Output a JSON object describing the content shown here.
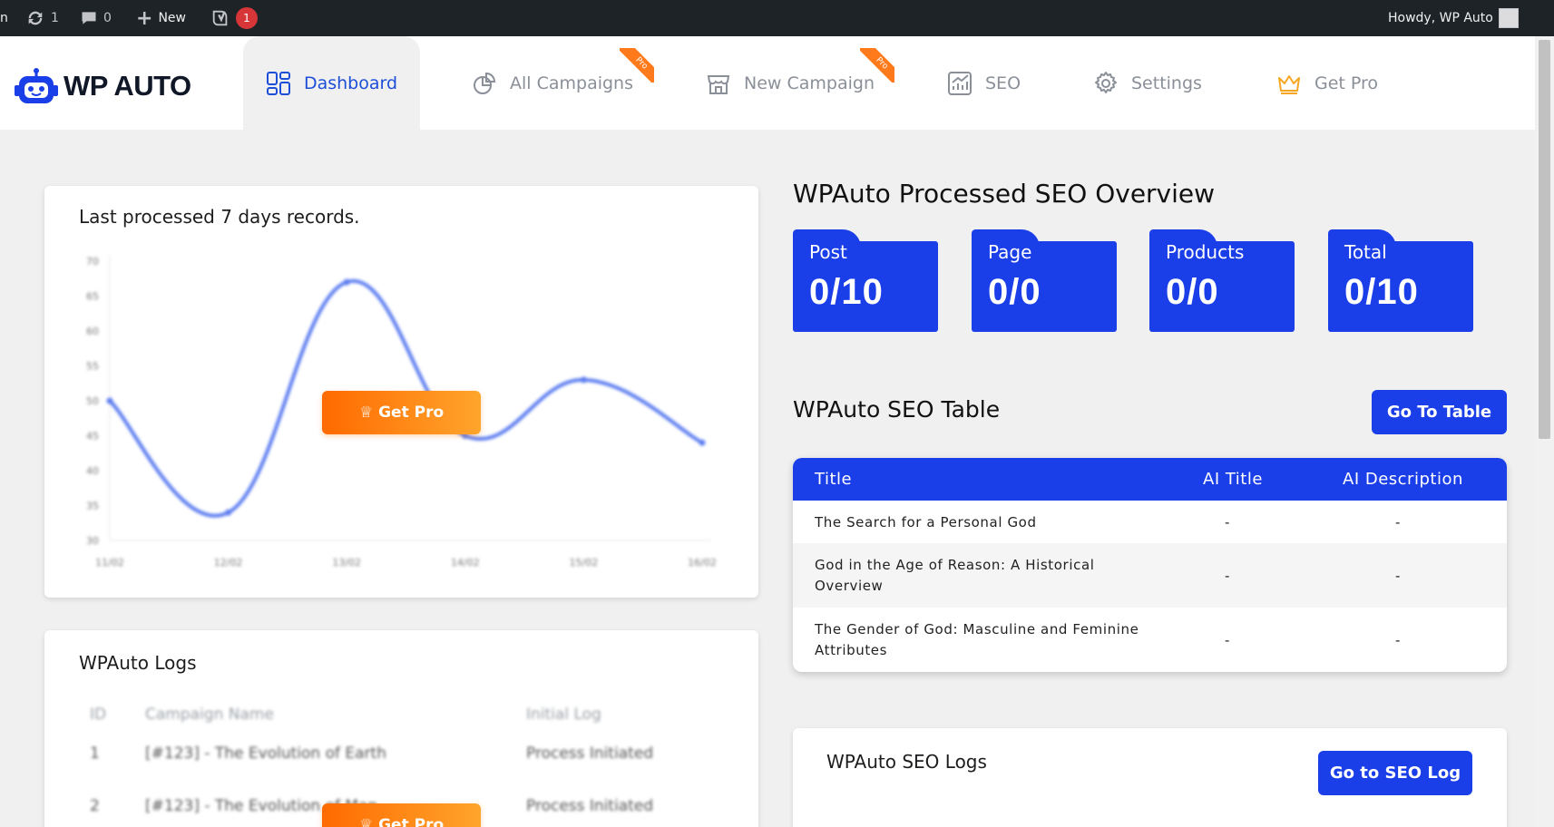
{
  "adminbar": {
    "cut_glyph": "n",
    "updates_count": "1",
    "comments_count": "0",
    "new_label": "New",
    "yoast_badge": "1",
    "howdy": "Howdy, WP Auto"
  },
  "brand": {
    "logo_text": "WP AUTO"
  },
  "nav": {
    "tabs": [
      {
        "label": "Dashboard",
        "icon": "dashboard-grid-icon",
        "active": true
      },
      {
        "label": "All Campaigns",
        "icon": "campaigns-icon",
        "badge": "Pro"
      },
      {
        "label": "New Campaign",
        "icon": "store-icon",
        "badge": "Pro"
      },
      {
        "label": "SEO",
        "icon": "seo-chart-icon"
      },
      {
        "label": "Settings",
        "icon": "gear-icon"
      },
      {
        "label": "Get Pro",
        "icon": "crown-icon"
      }
    ]
  },
  "records_card": {
    "title": "Last processed 7 days records.",
    "get_pro_label": "Get Pro"
  },
  "chart_data": {
    "type": "line",
    "x": [
      "11/02",
      "12/02",
      "13/02",
      "14/02",
      "15/02",
      "16/02"
    ],
    "series": [
      {
        "values": [
          50,
          34,
          67,
          45,
          53,
          44
        ]
      }
    ],
    "ylim": [
      30,
      70
    ],
    "yticks": [
      70,
      65,
      60,
      55,
      50,
      45,
      40,
      35,
      30
    ],
    "title": "",
    "xlabel": "",
    "ylabel": "",
    "color": "#5b7cf0"
  },
  "logs_card": {
    "title": "WPAuto Logs",
    "columns": [
      "ID",
      "Campaign Name",
      "Initial Log"
    ],
    "rows": [
      [
        "1",
        "[#123] - The Evolution of Earth",
        "Process Initiated"
      ],
      [
        "2",
        "[#123] - The Evolution of Man",
        "Process Initiated"
      ]
    ],
    "get_pro_label": "Get Pro"
  },
  "overview": {
    "title": "WPAuto Processed SEO Overview",
    "stats": [
      {
        "label": "Post",
        "value": "0/10"
      },
      {
        "label": "Page",
        "value": "0/0"
      },
      {
        "label": "Products",
        "value": "0/0"
      },
      {
        "label": "Total",
        "value": "0/10"
      }
    ]
  },
  "seo_table": {
    "title": "WPAuto SEO Table",
    "button": "Go To Table",
    "columns": [
      "Title",
      "AI Title",
      "AI Description"
    ],
    "rows": [
      [
        "The Search for a Personal God",
        "-",
        "-"
      ],
      [
        "God in the Age of Reason: A Historical Overview",
        "-",
        "-"
      ],
      [
        "The Gender of God: Masculine and Feminine Attributes",
        "-",
        "-"
      ]
    ]
  },
  "seo_logs": {
    "title": "WPAuto SEO Logs",
    "button": "Go to SEO Log"
  },
  "colors": {
    "primary": "#1a3ee8",
    "accent_orange": "#ff7a1a",
    "adminbar": "#1d2327",
    "page_bg": "#f0f0f1"
  }
}
